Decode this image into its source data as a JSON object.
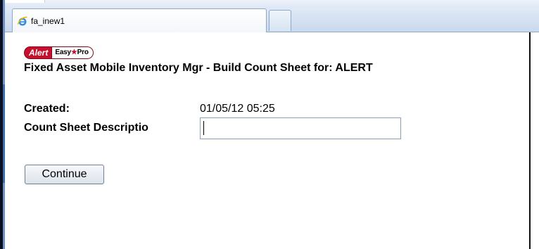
{
  "browser": {
    "tab_title": "fa_inew1",
    "tab_icon": "ie-icon"
  },
  "logo": {
    "alert": "Alert",
    "easy": "Easy",
    "star": "★",
    "pro": "Pro"
  },
  "page": {
    "title": "Fixed Asset Mobile Inventory Mgr - Build Count Sheet for: ALERT"
  },
  "form": {
    "created_label": "Created:",
    "created_value": "01/05/12 05:25",
    "description_label": "Count Sheet Descriptio",
    "description_value": "",
    "continue_label": "Continue"
  },
  "colors": {
    "brand_red": "#c8102e",
    "tab_border": "#8ea8c8"
  }
}
